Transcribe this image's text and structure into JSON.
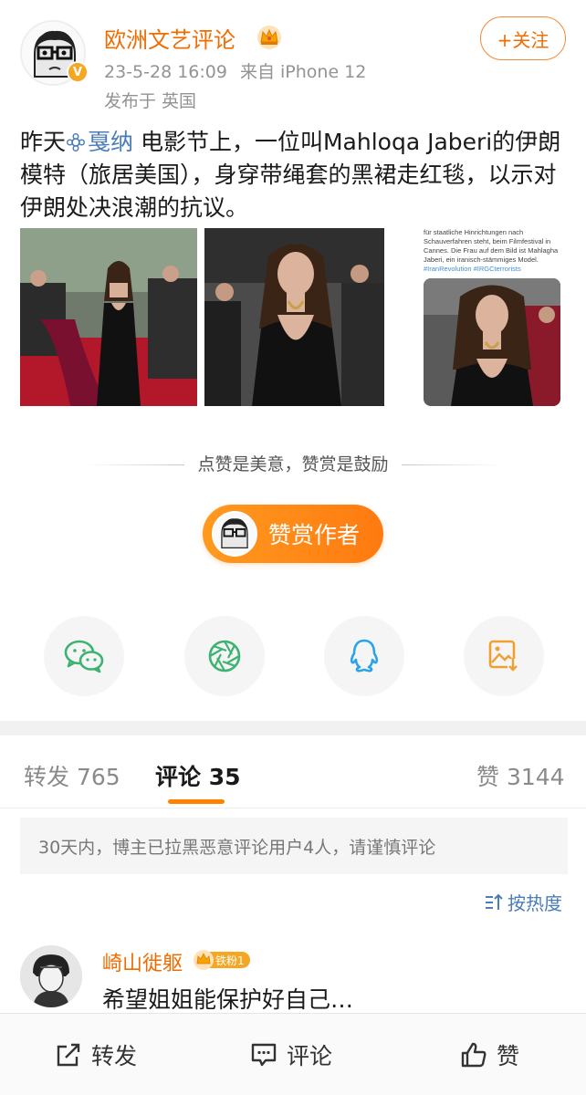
{
  "author": {
    "name": "欧洲文艺评论",
    "verified_badge": "V",
    "timestamp": "23-5-28 16:09",
    "source": "来自 iPhone 12",
    "location": "发布于 英国",
    "follow_label": "+关注"
  },
  "post": {
    "text_before": "昨天",
    "mention": "戛纳",
    "text_after": " 电影节上，一位叫Mahloqa Jaberi的伊朗模特（旅居美国），身穿带绳套的黑裙走红毯，以示对伊朗处决浪潮的抗议。",
    "photo3_caption_lines": [
      "für staatliche Hinrichtungen nach",
      "Schauverfahren steht, beim Filmfestival in",
      "Cannes. Die Frau auf dem Bild ist Mahlagha",
      "Jaberi, ein iranisch-stämmiges Model."
    ],
    "photo3_hashtags": "#IranRevolution #IRGCterrorists"
  },
  "reward": {
    "caption": "点赞是美意，赞赏是鼓励",
    "button_label": "赞赏作者"
  },
  "share": [
    "wechat-icon",
    "moments-icon",
    "qq-icon",
    "save-image-icon"
  ],
  "tabs": {
    "repost_label": "转发",
    "repost_count": "765",
    "comment_label": "评论",
    "comment_count": "35",
    "like_label": "赞",
    "like_count": "3144"
  },
  "notice": "30天内，博主已拉黑恶意评论用户4人，请谨慎评论",
  "sort_label": "按热度",
  "comment": {
    "username": "崎山徙躯",
    "fan_badge": "铁粉1",
    "text": "希望姐姐能保护好自己…"
  },
  "bottom_bar": {
    "repost": "转发",
    "comment": "评论",
    "like": "赞"
  },
  "colors": {
    "accent_orange": "#f06c00",
    "link_blue": "#4a7cb8",
    "reward_orange": "#ff8a14"
  }
}
